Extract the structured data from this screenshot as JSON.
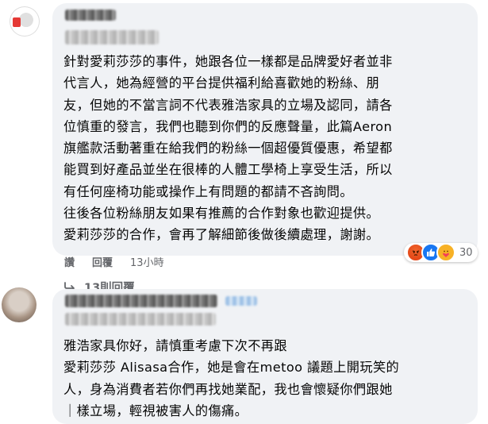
{
  "comments": [
    {
      "body": "針對愛莉莎莎的事件，她跟各位一樣都是品牌愛好者並非\n代言人，她為經營的平台提供福利給喜歡她的粉絲、朋\n友，但她的不當言詞不代表雅浩家具的立場及認同，請各\n位慎重的發言，我們也聽到你們的反應聲量，此篇Aeron\n旗艦款活動著重在給我們的粉絲一個超優質優惠，希望都\n能買到好產品並坐在很棒的人體工學椅上享受生活，所以\n有任何座椅功能或操作上有問題的都請不吝詢問。\n往後各位粉絲朋友如果有推薦的合作對象也歡迎提供。\n愛莉莎莎的合作，會再了解細節後做後續處理，謝謝。",
      "actions": {
        "like_label": "讚",
        "reply_label": "回覆",
        "timestamp": "13小時"
      },
      "reactions": {
        "icons": [
          "angry-icon",
          "like-icon",
          "care-icon"
        ],
        "count": "30"
      },
      "replies_label": "13則回覆"
    },
    {
      "body": "雅浩家具你好，請慎重考慮下次不再跟\n愛莉莎莎 Alisasa合作，她是會在metoo 議題上開玩笑的\n人，身為消費者若你們再找她業配，我也會懷疑你們跟她\n｜樣立場，輕視被害人的傷痛。"
    }
  ],
  "colors": {
    "bubble": "#f0f2f5",
    "meta_text": "#65676b",
    "angry": "#e03b0f",
    "like": "#1877f2",
    "care": "#f7b125"
  }
}
